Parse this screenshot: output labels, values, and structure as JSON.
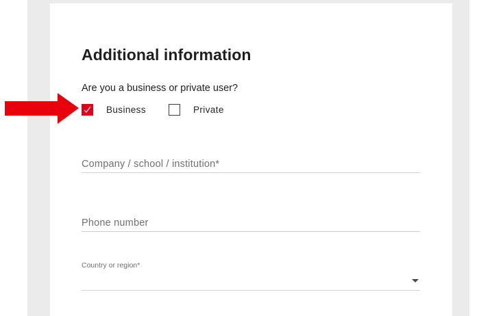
{
  "form": {
    "title": "Additional information",
    "user_type_question": "Are you a business or private user?",
    "options": [
      {
        "label": "Business",
        "checked": true
      },
      {
        "label": "Private",
        "checked": false
      }
    ],
    "company_placeholder": "Company / school / institution*",
    "phone_placeholder": "Phone number",
    "country_label": "Country or region*",
    "country_value": ""
  },
  "annotation": {
    "arrow_icon": "right-arrow-icon",
    "arrow_color": "#e8000b"
  },
  "colors": {
    "accent": "#e2001a",
    "background_band": "#ebebeb",
    "card": "#ffffff"
  }
}
